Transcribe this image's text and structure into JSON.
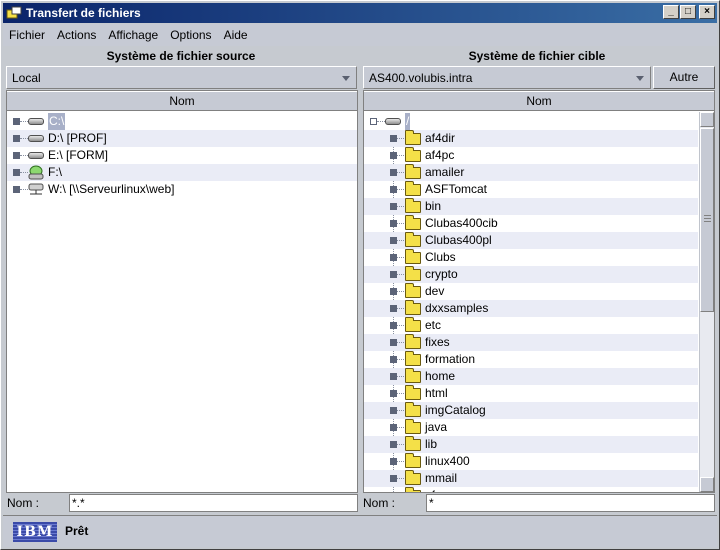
{
  "window": {
    "title": "Transfert de fichiers",
    "minimize": "_",
    "maximize": "□",
    "close": "×"
  },
  "menu": [
    "Fichier",
    "Actions",
    "Affichage",
    "Options",
    "Aide"
  ],
  "source": {
    "header": "Système de fichier source",
    "system": "Local",
    "column": "Nom",
    "items": [
      {
        "label": "C:\\",
        "icon": "hard-drive-icon",
        "selected": true
      },
      {
        "label": "D:\\ [PROF]",
        "icon": "hard-drive-icon"
      },
      {
        "label": "E:\\ [FORM]",
        "icon": "hard-drive-icon"
      },
      {
        "label": "F:\\",
        "icon": "cd-drive-icon"
      },
      {
        "label": "W:\\ [\\\\Serveurlinux\\web]",
        "icon": "network-drive-icon"
      }
    ],
    "name_label": "Nom :",
    "name_value": "*.*"
  },
  "target": {
    "header": "Système de fichier cible",
    "system": "AS400.volubis.intra",
    "other_button": "Autre",
    "column": "Nom",
    "root": "/",
    "folders": [
      "af4dir",
      "af4pc",
      "amailer",
      "ASFTomcat",
      "bin",
      "Clubas400cib",
      "Clubas400pl",
      "Clubs",
      "crypto",
      "dev",
      "dxxsamples",
      "etc",
      "fixes",
      "formation",
      "home",
      "html",
      "imgCatalog",
      "java",
      "lib",
      "linux400",
      "mmail",
      "nfs"
    ],
    "name_label": "Nom :",
    "name_value": "*"
  },
  "status": {
    "logo": "IBM",
    "text": "Prêt"
  }
}
